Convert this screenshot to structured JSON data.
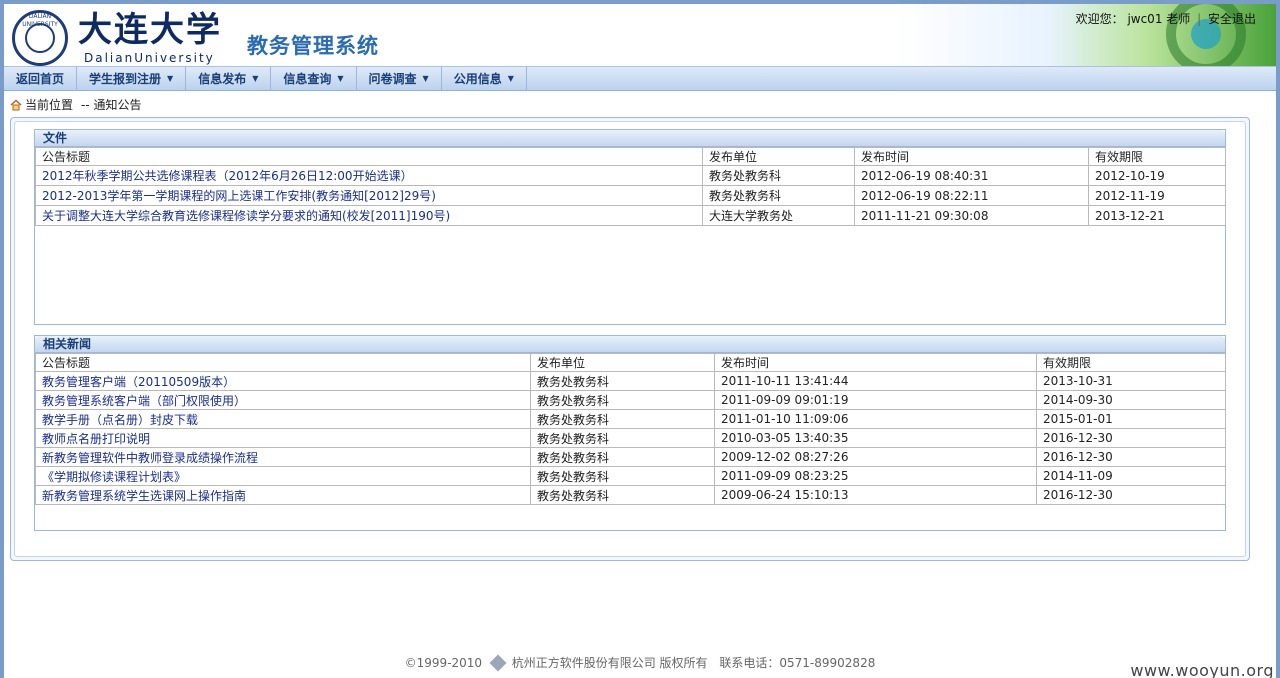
{
  "header": {
    "university_cn": "大连大学",
    "university_en": "DalianUniversity",
    "seal_text": "DALIAN UNIVERSITY",
    "system_title": "教务管理系统",
    "welcome": "欢迎您：",
    "user": "jwc01 老师",
    "separator": "|",
    "logout": "安全退出"
  },
  "nav": [
    {
      "label": "返回首页",
      "caret": false
    },
    {
      "label": "学生报到注册",
      "caret": true
    },
    {
      "label": "信息发布",
      "caret": true
    },
    {
      "label": "信息查询",
      "caret": true
    },
    {
      "label": "问卷调查",
      "caret": true
    },
    {
      "label": "公用信息",
      "caret": true
    }
  ],
  "breadcrumb": {
    "label": "当前位置",
    "path": "-- 通知公告"
  },
  "files": {
    "title": "文件",
    "columns": [
      "公告标题",
      "发布单位",
      "发布时间",
      "有效期限"
    ],
    "rows": [
      [
        "2012年秋季学期公共选修课程表（2012年6月26日12:00开始选课）",
        "教务处教务科",
        "2012-06-19 08:40:31",
        "2012-10-19"
      ],
      [
        "2012-2013学年第一学期课程的网上选课工作安排(教务通知[2012]29号)",
        "教务处教务科",
        "2012-06-19 08:22:11",
        "2012-11-19"
      ],
      [
        "关于调整大连大学综合教育选修课程修读学分要求的通知(校发[2011]190号)",
        "大连大学教务处",
        "2011-11-21 09:30:08",
        "2013-12-21"
      ]
    ]
  },
  "news": {
    "title": "相关新闻",
    "columns": [
      "公告标题",
      "发布单位",
      "发布时间",
      "有效期限"
    ],
    "rows": [
      [
        "教务管理客户端（20110509版本）",
        "教务处教务科",
        "2011-10-11 13:41:44",
        "2013-10-31"
      ],
      [
        "教务管理系统客户端（部门权限使用）",
        "教务处教务科",
        "2011-09-09 09:01:19",
        "2014-09-30"
      ],
      [
        "教学手册（点名册）封皮下载",
        "教务处教务科",
        "2011-01-10 11:09:06",
        "2015-01-01"
      ],
      [
        "教师点名册打印说明",
        "教务处教务科",
        "2010-03-05 13:40:35",
        "2016-12-30"
      ],
      [
        "新教务管理软件中教师登录成绩操作流程",
        "教务处教务科",
        "2009-12-02 08:27:26",
        "2016-12-30"
      ],
      [
        "《学期拟修读课程计划表》",
        "教务处教务科",
        "2011-09-09 08:23:25",
        "2014-11-09"
      ],
      [
        "新教务管理系统学生选课网上操作指南",
        "教务处教务科",
        "2009-06-24 15:10:13",
        "2016-12-30"
      ]
    ]
  },
  "footer": {
    "copyright": "©1999-2010",
    "company": "杭州正方软件股份有限公司 版权所有",
    "phone": "联系电话：0571-89902828"
  },
  "watermark": "www.wooyun.org"
}
